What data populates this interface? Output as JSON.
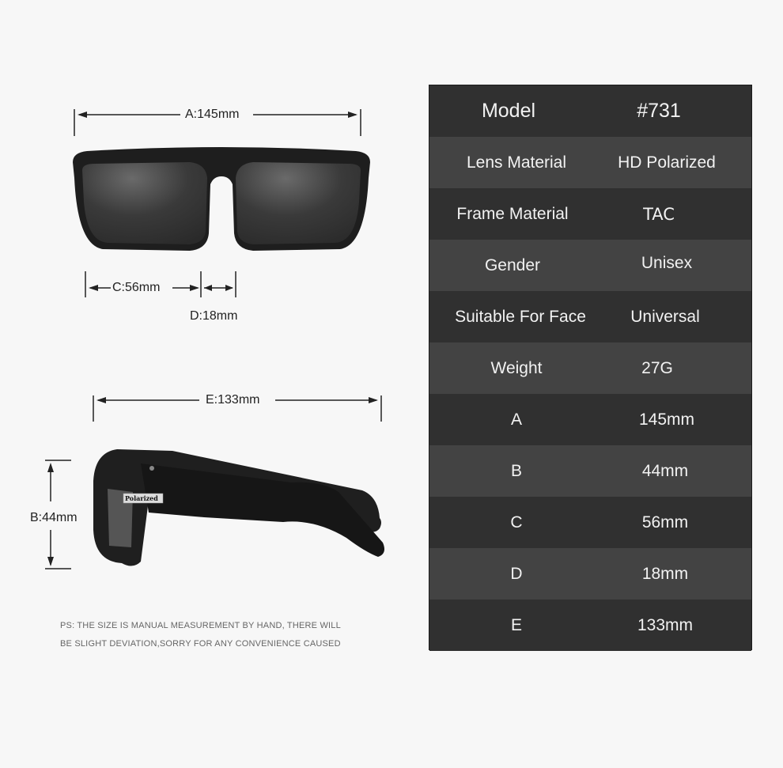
{
  "front_view": {
    "width_label": "A:145mm",
    "lens_width_label": "C:56mm",
    "bridge_label": "D:18mm"
  },
  "side_view": {
    "temple_label": "E:133mm",
    "lens_height_label": "B:44mm",
    "temple_badge": "Polarized"
  },
  "note": {
    "line1": "PS: THE SIZE IS MANUAL MEASUREMENT BY HAND, THERE WILL",
    "line2": "BE SLIGHT DEVIATION,SORRY FOR ANY CONVENIENCE CAUSED"
  },
  "specs": {
    "rows": [
      {
        "label": "Model",
        "value": "#731"
      },
      {
        "label": "Lens Material",
        "value": "HD Polarized"
      },
      {
        "label": "Frame Material",
        "value": "TAC"
      },
      {
        "label": "Gender",
        "value": "Unisex"
      },
      {
        "label": "Suitable For Face",
        "value": "Universal"
      },
      {
        "label": "Weight",
        "value": "27G"
      },
      {
        "label": "A",
        "value": "145mm"
      },
      {
        "label": "B",
        "value": "44mm"
      },
      {
        "label": "C",
        "value": "56mm"
      },
      {
        "label": "D",
        "value": "18mm"
      },
      {
        "label": "E",
        "value": "133mm"
      }
    ]
  },
  "colors": {
    "table_dark": "#303030",
    "table_light": "#434343",
    "background": "#f7f7f7"
  }
}
